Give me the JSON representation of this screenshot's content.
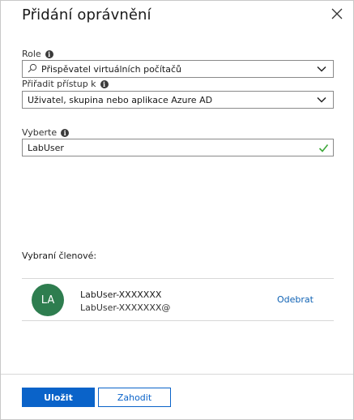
{
  "panel": {
    "title": "Přidání oprávnění"
  },
  "role": {
    "label": "Role",
    "value": "Přispěvatel virtuálních počítačů"
  },
  "assign_access": {
    "label": "Přiřadit přístup k",
    "value": "Uživatel, skupina nebo aplikace Azure AD"
  },
  "select": {
    "label": "Vyberte",
    "value": "LabUser"
  },
  "members": {
    "title": "Vybraní členové:",
    "items": [
      {
        "initials": "LA",
        "name": "LabUser-XXXXXXX",
        "email": "LabUser-XXXXXXX@",
        "remove_label": "Odebrat"
      }
    ]
  },
  "footer": {
    "save_label": "Uložit",
    "discard_label": "Zahodit"
  },
  "colors": {
    "accent": "#0a63c9",
    "avatar_bg": "#2e7d4f",
    "valid_check": "#3ea83a"
  }
}
